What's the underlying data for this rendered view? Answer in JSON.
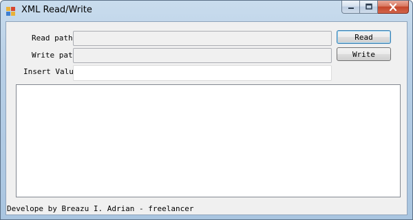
{
  "window": {
    "title": "XML Read/Write",
    "icon": "app-window-icon",
    "caption_buttons": {
      "minimize": "minimize-icon",
      "maximize": "maximize-icon",
      "close": "close-icon"
    }
  },
  "form": {
    "read_path_label": "Read path",
    "write_path_label": "Write path",
    "insert_value_label": "Insert Value",
    "read_path_value": "",
    "write_path_value": "",
    "insert_value_value": "",
    "read_button": "Read",
    "write_button": "Write",
    "output_text": ""
  },
  "footer": {
    "credit": "Develope by Breazu I. Adrian - freelancer"
  },
  "colors": {
    "client_background": "#f0f0f0",
    "close_button": "#c4452a",
    "focus_border": "#3c7fb1"
  }
}
